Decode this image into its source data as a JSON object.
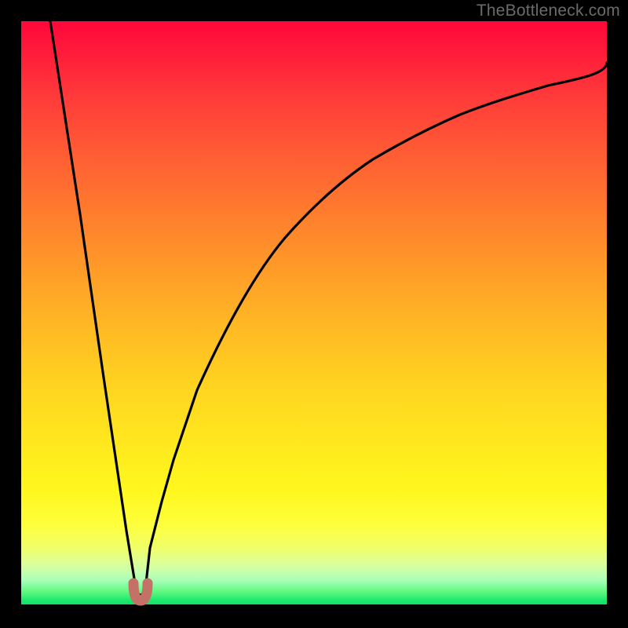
{
  "watermark": "TheBottleneck.com",
  "colors": {
    "frame": "#000000",
    "curve": "#000000",
    "marker": "#c47268"
  },
  "chart_data": {
    "type": "line",
    "title": "",
    "xlabel": "",
    "ylabel": "",
    "xlim": [
      0,
      100
    ],
    "ylim": [
      0,
      100
    ],
    "grid": false,
    "legend": false,
    "curve": {
      "description": "V-shaped bottleneck curve with minimum near x≈20.",
      "x": [
        5,
        8,
        10,
        12,
        14,
        16,
        18,
        19.5,
        20,
        20.5,
        22,
        24,
        26,
        30,
        35,
        40,
        45,
        50,
        55,
        60,
        65,
        70,
        75,
        80,
        85,
        90,
        95,
        100
      ],
      "y": [
        100,
        80,
        67,
        53,
        40,
        27,
        13,
        4,
        2,
        4,
        10,
        18,
        25,
        37,
        48,
        57,
        63,
        69,
        73,
        77,
        80,
        83,
        85,
        87.5,
        89,
        90.5,
        92,
        93
      ]
    },
    "marker": {
      "description": "Small U-shaped marker at curve minimum",
      "x_range": [
        19,
        21
      ],
      "y": 2
    },
    "gradient": {
      "description": "Vertical rainbow heat gradient from red (top) through orange/yellow to green (bottom)",
      "stops": [
        {
          "pos": 0.0,
          "color": "#ff073a"
        },
        {
          "pos": 0.5,
          "color": "#ffc722"
        },
        {
          "pos": 0.85,
          "color": "#fdff3c"
        },
        {
          "pos": 1.0,
          "color": "#0fdc6a"
        }
      ]
    }
  }
}
